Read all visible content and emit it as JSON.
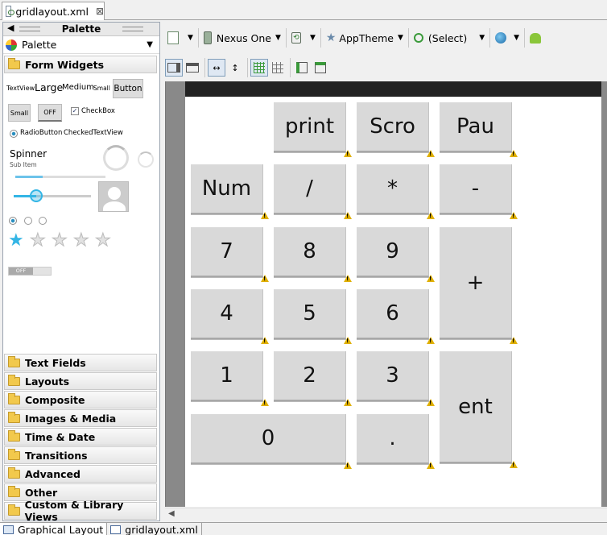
{
  "editor_tab": {
    "file": "gridlayout.xml",
    "close": "⊠"
  },
  "palette": {
    "title": "Palette",
    "header": "Palette",
    "categories": {
      "form_widgets": "Form Widgets",
      "list": [
        "Text Fields",
        "Layouts",
        "Composite",
        "Images & Media",
        "Time & Date",
        "Transitions",
        "Advanced",
        "Other",
        "Custom & Library Views"
      ]
    },
    "widgets": {
      "textview": "TextView",
      "large": "Large",
      "medium": "Medium",
      "small": "Small",
      "button": "Button",
      "small_button": "Small",
      "off_toggle": "OFF",
      "checkbox": "CheckBox",
      "radiobutton": "RadioButton",
      "checkedtextview": "CheckedTextView",
      "spinner": "Spinner",
      "spinner_sub": "Sub Item",
      "switch_off": "OFF",
      "rating_value": 1,
      "rating_max": 5
    }
  },
  "toolbar": {
    "device": "Nexus One",
    "theme": "AppTheme",
    "activity": "(Select)"
  },
  "keys": [
    {
      "label": "print"
    },
    {
      "label": "Scro"
    },
    {
      "label": "Pau"
    },
    {
      "label": "Num"
    },
    {
      "label": "/"
    },
    {
      "label": "*"
    },
    {
      "label": "-"
    },
    {
      "label": "7"
    },
    {
      "label": "8"
    },
    {
      "label": "9"
    },
    {
      "label": "+"
    },
    {
      "label": "4"
    },
    {
      "label": "5"
    },
    {
      "label": "6"
    },
    {
      "label": "1"
    },
    {
      "label": "2"
    },
    {
      "label": "3"
    },
    {
      "label": "ent"
    },
    {
      "label": "0"
    },
    {
      "label": "."
    }
  ],
  "bottom_tabs": [
    "Graphical Layout",
    "gridlayout.xml"
  ],
  "colors": {
    "accent": "#33b5e5",
    "key_bg": "#d9d9d9",
    "canvas_bg": "#898989",
    "warning": "#e0b000"
  }
}
